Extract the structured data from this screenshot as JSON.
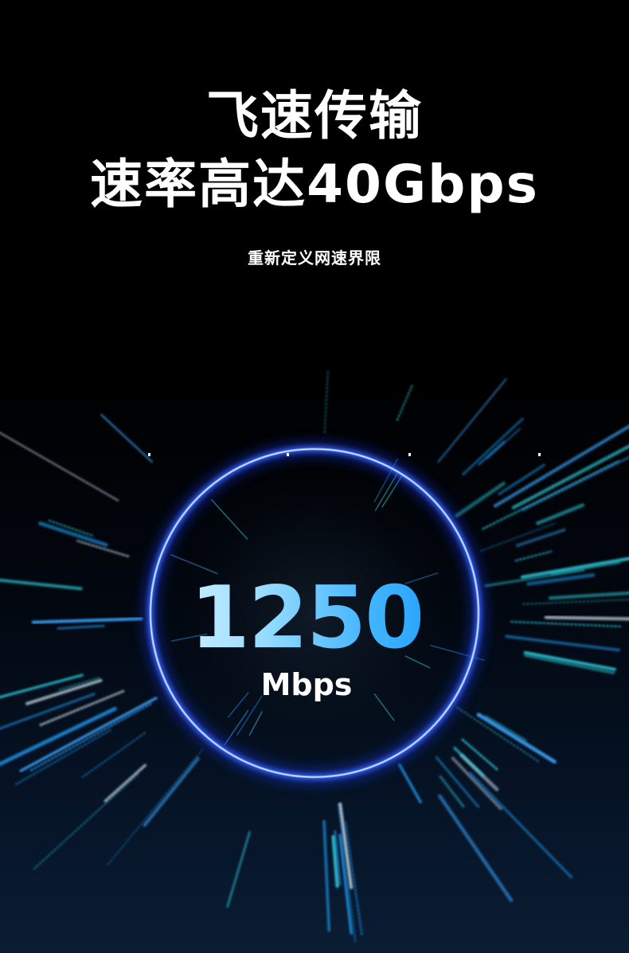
{
  "headline": {
    "line1": "飞速传输",
    "line2": "速率高达40Gbps"
  },
  "subtitle": "重新定义网速界限",
  "speed_display": {
    "value": "1250",
    "unit": "Mbps"
  },
  "colors": {
    "background": "#000000",
    "ring": "#3e6bff",
    "ring_glow": "#1e3cff",
    "streak_blue": "#1a8fe0",
    "streak_cyan": "#2fd0e0",
    "number_gradient_start": "#d8f3ff",
    "number_gradient_end": "#1a9cff"
  }
}
